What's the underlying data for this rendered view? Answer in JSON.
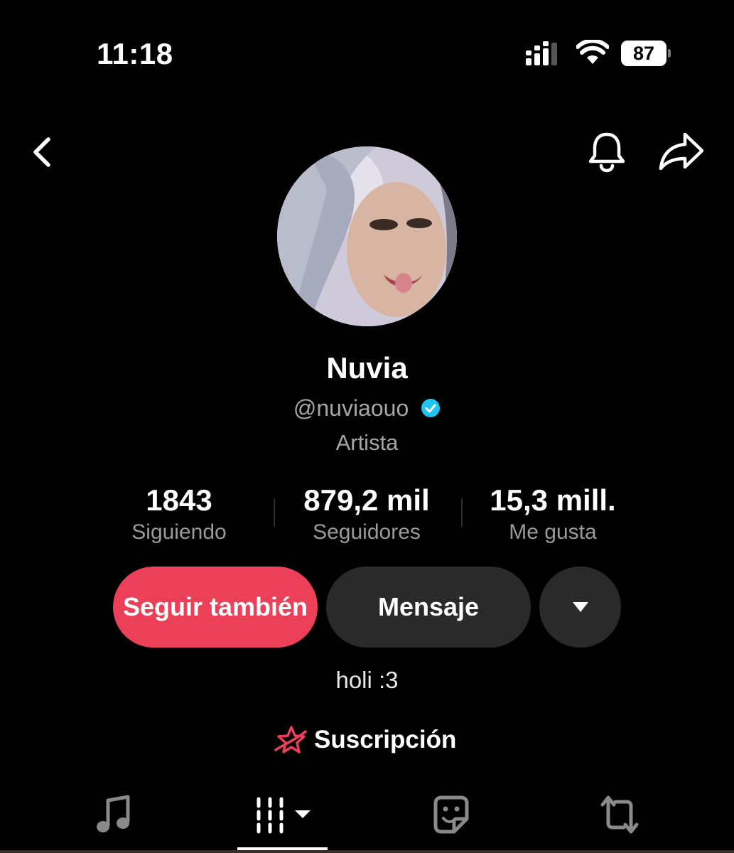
{
  "status_bar": {
    "time": "11:18",
    "battery": "87"
  },
  "profile": {
    "name": "Nuvia",
    "handle": "@nuviaouo",
    "category": "Artista",
    "bio": "holi :3",
    "subscription_label": "Suscripción"
  },
  "stats": [
    {
      "value": "1843",
      "label": "Siguiendo"
    },
    {
      "value": "879,2 mil",
      "label": "Seguidores"
    },
    {
      "value": "15,3 mill.",
      "label": "Me gusta"
    }
  ],
  "actions": {
    "follow_label": "Seguir también",
    "message_label": "Mensaje"
  },
  "icons": {
    "back": "chevron-left-icon",
    "notify": "bell-icon",
    "share": "share-arrow-icon",
    "verified": "verified-check-icon",
    "more": "caret-down-icon",
    "subscription": "star-icon",
    "tabs": [
      "music-note-icon",
      "grid-icon",
      "sticker-icon",
      "repost-icon"
    ]
  },
  "colors": {
    "background": "#000000",
    "follow_button": "#eb4057",
    "secondary_button": "#2a2a2a",
    "verified": "#20c4f4",
    "muted_text": "#a6a6a6"
  }
}
